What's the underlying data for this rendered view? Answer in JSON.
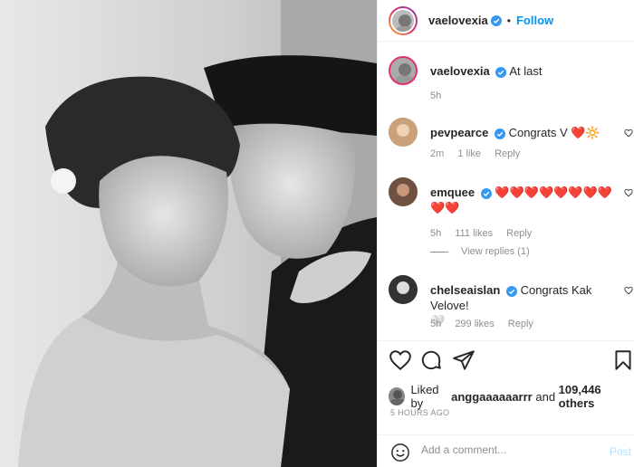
{
  "post_author": {
    "username": "vaelovexia",
    "follow_label": "Follow",
    "dot": "•"
  },
  "caption": {
    "username": "vaelovexia",
    "text": "At last",
    "time": "5h"
  },
  "comments": [
    {
      "username": "pevpearce",
      "text": "Congrats V",
      "emojis": "❤️🔆",
      "time": "2m",
      "likes": "1 like",
      "reply": "Reply"
    },
    {
      "username": "emquee",
      "text": "",
      "emojis_line1": "❤️❤️❤️❤️❤️❤️❤️❤️",
      "emojis_line2": "❤️❤️",
      "time": "5h",
      "likes": "111 likes",
      "reply": "Reply"
    },
    {
      "username": "chelseaislan",
      "text": "Congrats Kak Velove!",
      "emojis": "🤍",
      "time": "5h",
      "likes": "299 likes",
      "reply": "Reply"
    }
  ],
  "view_replies": "View replies (1)",
  "liked_by": {
    "prefix": "Liked by ",
    "user": "anggaaaaaarrr",
    "and": " and ",
    "count": "109,446 others"
  },
  "timestamp": "5 HOURS AGO",
  "add_comment": {
    "placeholder": "Add a comment...",
    "post_label": "Post"
  },
  "colors": {
    "accent": "#0095f6",
    "heart": "#ed4956",
    "muted": "#8e8e8e"
  }
}
